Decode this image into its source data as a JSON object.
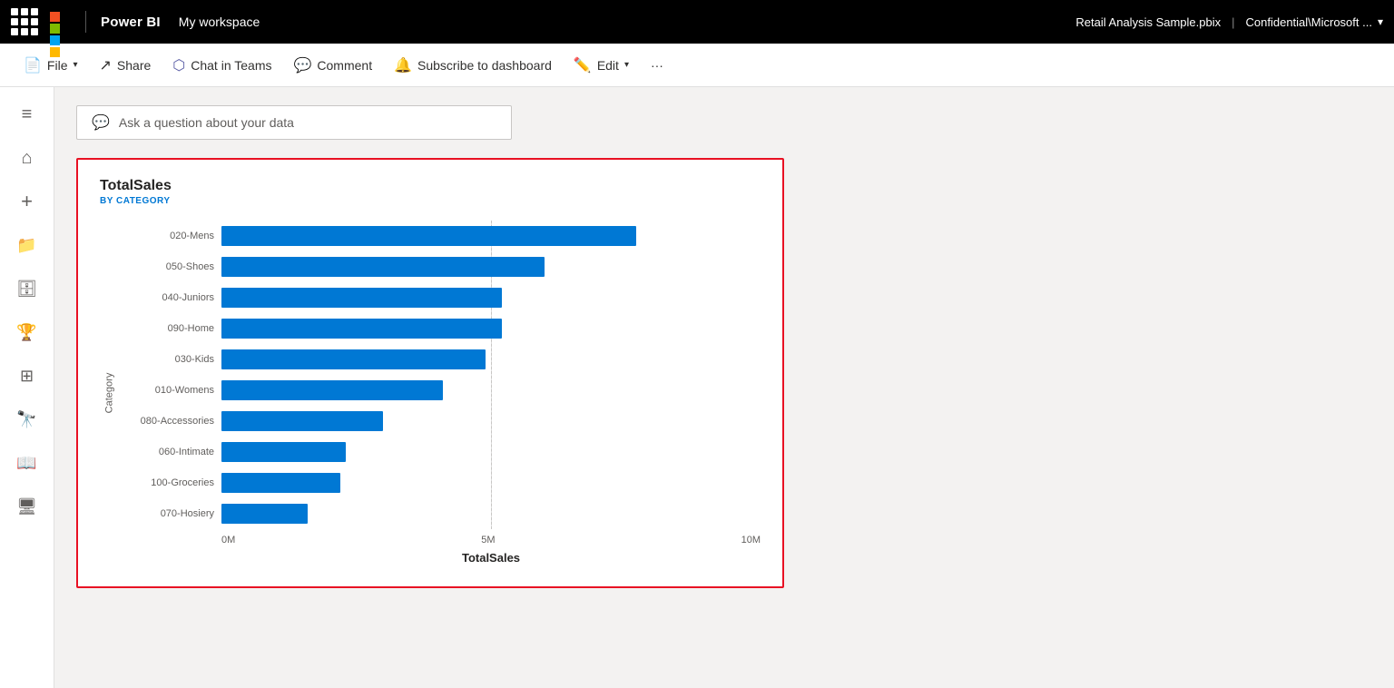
{
  "topbar": {
    "app_name": "Power BI",
    "workspace": "My workspace",
    "filename": "Retail Analysis Sample.pbix",
    "separator": "|",
    "confidential": "Confidential\\Microsoft ...",
    "chevron": "▾"
  },
  "toolbar": {
    "file_label": "File",
    "share_label": "Share",
    "chat_in_teams_label": "Chat in Teams",
    "comment_label": "Comment",
    "subscribe_label": "Subscribe to dashboard",
    "edit_label": "Edit",
    "more_label": "···"
  },
  "sidebar": {
    "items": [
      {
        "name": "hamburger",
        "icon": "≡",
        "active": false
      },
      {
        "name": "home",
        "icon": "⌂",
        "active": false
      },
      {
        "name": "create",
        "icon": "+",
        "active": false
      },
      {
        "name": "browse",
        "icon": "⊞",
        "active": false
      },
      {
        "name": "data-hub",
        "icon": "⬡",
        "active": false
      },
      {
        "name": "goals",
        "icon": "◎",
        "active": false
      },
      {
        "name": "apps",
        "icon": "⊞",
        "active": false
      },
      {
        "name": "learn",
        "icon": "⊙",
        "active": false
      },
      {
        "name": "book",
        "icon": "📖",
        "active": false
      },
      {
        "name": "monitor",
        "icon": "🖥",
        "active": false
      }
    ]
  },
  "ask_bar": {
    "placeholder": "Ask a question about your data",
    "icon": "💬"
  },
  "chart": {
    "title": "TotalSales",
    "subtitle": "BY CATEGORY",
    "y_axis_label": "Category",
    "x_axis_label": "TotalSales",
    "x_axis_ticks": [
      "0M",
      "5M",
      "10M"
    ],
    "bars": [
      {
        "label": "020-Mens",
        "value": 77
      },
      {
        "label": "050-Shoes",
        "value": 60
      },
      {
        "label": "040-Juniors",
        "value": 52
      },
      {
        "label": "090-Home",
        "value": 52
      },
      {
        "label": "030-Kids",
        "value": 49
      },
      {
        "label": "010-Womens",
        "value": 41
      },
      {
        "label": "080-Accessories",
        "value": 30
      },
      {
        "label": "060-Intimate",
        "value": 23
      },
      {
        "label": "100-Groceries",
        "value": 22
      },
      {
        "label": "070-Hosiery",
        "value": 16
      }
    ],
    "bar_color": "#0078d4",
    "grid_lines": [
      50,
      100
    ]
  },
  "ms_logo": {
    "colors": [
      "#f25022",
      "#7fba00",
      "#00a4ef",
      "#ffb900"
    ]
  }
}
